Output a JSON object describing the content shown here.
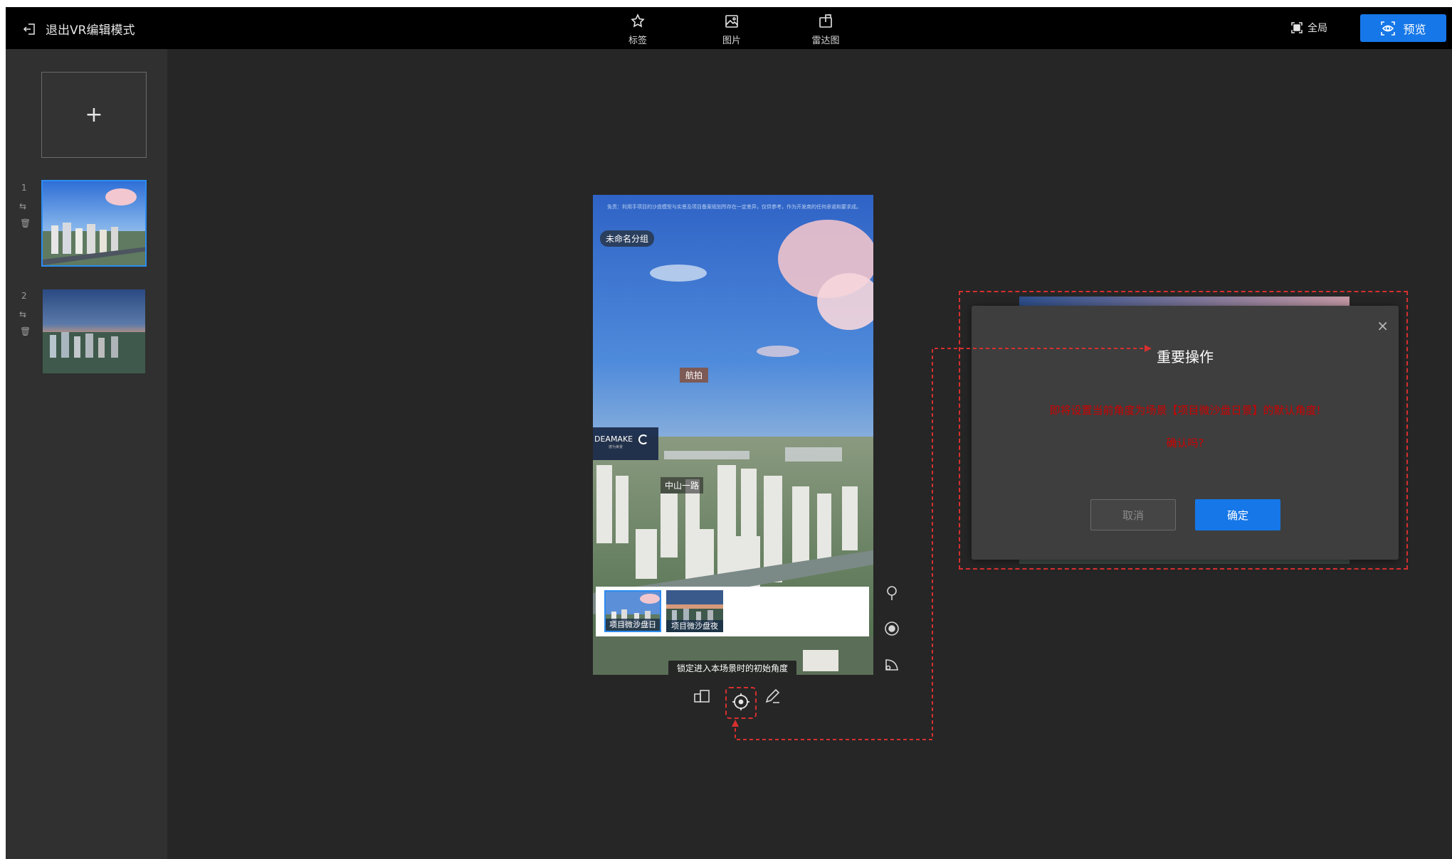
{
  "topbar": {
    "exit_label": "退出VR编辑模式",
    "tools": [
      {
        "label": "标签",
        "icon": "pin-star-icon"
      },
      {
        "label": "图片",
        "icon": "image-icon"
      },
      {
        "label": "雷达图",
        "icon": "radar-icon"
      }
    ],
    "fullscreen_label": "全局",
    "preview_label": "预览"
  },
  "sidebar": {
    "add_label": "+",
    "scenes": [
      {
        "index": "1",
        "name": "项目微沙盘日"
      },
      {
        "index": "2",
        "name": "项目微沙盘夜"
      }
    ]
  },
  "phone": {
    "disclaimer": "免责：利用手项目的沙盘模型与实景及项目备案规划所存在一定差异，仅供参考，作为开发商的任何承诺和要求成。",
    "group_tag": "未命名分组",
    "hotspots": {
      "hangbo": "航拍",
      "road": "中山一路"
    },
    "logo_text": "DEAMAKE",
    "logo_sub": "德为美景",
    "strip": [
      {
        "label": "项目微沙盘日",
        "active": true
      },
      {
        "label": "项目微沙盘夜",
        "active": false
      }
    ],
    "tooltip": "锁定进入本场景时的初始角度"
  },
  "modal": {
    "title": "重要操作",
    "message": "即将设置当前角度为场景【项目微沙盘日景】的默认角度!",
    "confirm_question": "确认吗?",
    "cancel_label": "取消",
    "ok_label": "确定",
    "close_glyph": "×"
  },
  "colors": {
    "accent": "#1677e8",
    "annotation": "#d62f2f",
    "warning_text": "#cc0000"
  }
}
